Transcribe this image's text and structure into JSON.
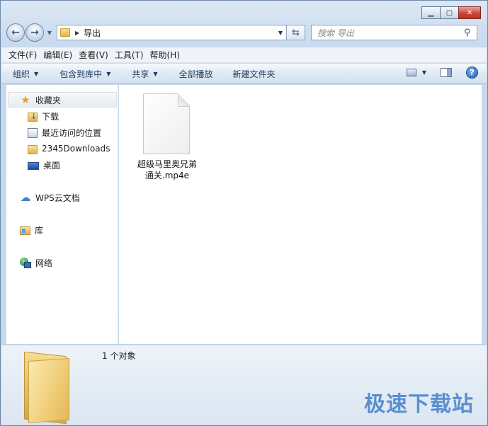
{
  "address": {
    "path": "导出"
  },
  "search": {
    "placeholder": "搜索 导出"
  },
  "menu": [
    "文件(F)",
    "编辑(E)",
    "查看(V)",
    "工具(T)",
    "帮助(H)"
  ],
  "commands": {
    "organize": "组织",
    "include_library": "包含到库中",
    "share": "共享",
    "play_all": "全部播放",
    "new_folder": "新建文件夹"
  },
  "nav": {
    "favorites": "收藏夹",
    "downloads": "下载",
    "recent": "最近访问的位置",
    "downloads_2345": "2345Downloads",
    "desktop": "桌面",
    "wps_cloud": "WPS云文档",
    "libraries": "库",
    "network": "网络"
  },
  "file": {
    "name_line1": "超级马里奥兄弟",
    "name_line2": "通关.mp4e"
  },
  "details": {
    "count": "1 个对象"
  },
  "watermark": "极速下载站"
}
